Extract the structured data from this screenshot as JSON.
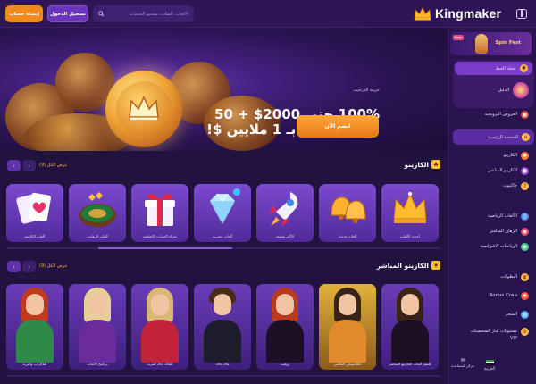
{
  "header": {
    "signup_label": "إنشاء حساب",
    "login_label": "تسجيل الدخول",
    "search_placeholder": "الألعاب، الفئات، مقدمو الخدمات",
    "logo_text": "Kingmaker"
  },
  "sidebar": {
    "promo_tag": "New",
    "promo_label": "Spin Fest",
    "items": [
      {
        "label": "عجلة الحظ",
        "icon": "wheel-icon"
      },
      {
        "label": "الدليل",
        "icon": "book-icon"
      },
      {
        "label": "العروض الترويجية",
        "icon": "gift-icon"
      },
      {
        "label": "الصفحة الرئيسية",
        "icon": "home-icon"
      },
      {
        "label": "الكازينو",
        "icon": "cards-icon"
      },
      {
        "label": "الكازينو المباشر",
        "icon": "dealer-icon"
      },
      {
        "label": "جاكبوت",
        "icon": "jackpot-icon"
      },
      {
        "label": "الألعاب الرياضية",
        "icon": "ball-icon"
      },
      {
        "label": "الرهان المباشر",
        "icon": "live-icon"
      },
      {
        "label": "الرياضات الافتراضية",
        "icon": "controller-icon"
      },
      {
        "label": "البطولات",
        "icon": "trophy-icon"
      },
      {
        "label": "Bonus Crab",
        "icon": "crab-icon"
      },
      {
        "label": "المتجر",
        "icon": "shop-icon"
      },
      {
        "label": "مستويات كبار الشخصيات VIP",
        "icon": "crown-icon"
      }
    ],
    "language_label": "العربية",
    "help_label": "مركز المساعدة"
  },
  "banner": {
    "small_text": "حزمة الترحيب",
    "line1": "100% حتى 2000$ + 50",
    "line2": "فرصة للفوز بـ 1 ملايين $!",
    "cta_label": "انضم الآن"
  },
  "casino": {
    "title": "الكازينو",
    "view_all": "عرض الكل (9)",
    "cards": [
      {
        "label": "ألعاب الكازينو",
        "art": "cards"
      },
      {
        "label": "ألعاب الروليت",
        "art": "roulette"
      },
      {
        "label": "شراء الميزات الإضافية",
        "art": "gift"
      },
      {
        "label": "ألعاب حصرية",
        "art": "diamond"
      },
      {
        "label": "الأكثر شعبية",
        "art": "rocket"
      },
      {
        "label": "ألعاب جديدة",
        "art": "bells"
      },
      {
        "label": "أحدث الألعاب",
        "art": "crown"
      }
    ]
  },
  "live_casino": {
    "title": "الكازينو المباشر",
    "view_all": "عرض الكل (9)",
    "cards": [
      {
        "label": "الباكارات والتريد",
        "hair": "#c23a1e",
        "dress": "#2f8a4a"
      },
      {
        "label": "برنامج الألعاب",
        "hair": "#e7cf97",
        "dress": "#6a2c9a"
      },
      {
        "label": "البلاك جاك المرنة",
        "hair": "#d9b774",
        "dress": "#c0243a"
      },
      {
        "label": "بلاك جاك",
        "hair": "#4a2a18",
        "dress": "#1c1c2c"
      },
      {
        "label": "روليت",
        "hair": "#b83a20",
        "dress": "#1e1024"
      },
      {
        "label": "الكلاسيكي العالمي",
        "hair": "#3a2418",
        "dress": "#e08a2c"
      },
      {
        "label": "أفضل ألعاب الكازينو المباشر",
        "hair": "#3a2418",
        "dress": "#1e1024"
      }
    ]
  },
  "colors": {
    "accent": "#f08a1c",
    "sidebar_active": "#7b3cc9",
    "card_bg": "#6a3cb8"
  }
}
